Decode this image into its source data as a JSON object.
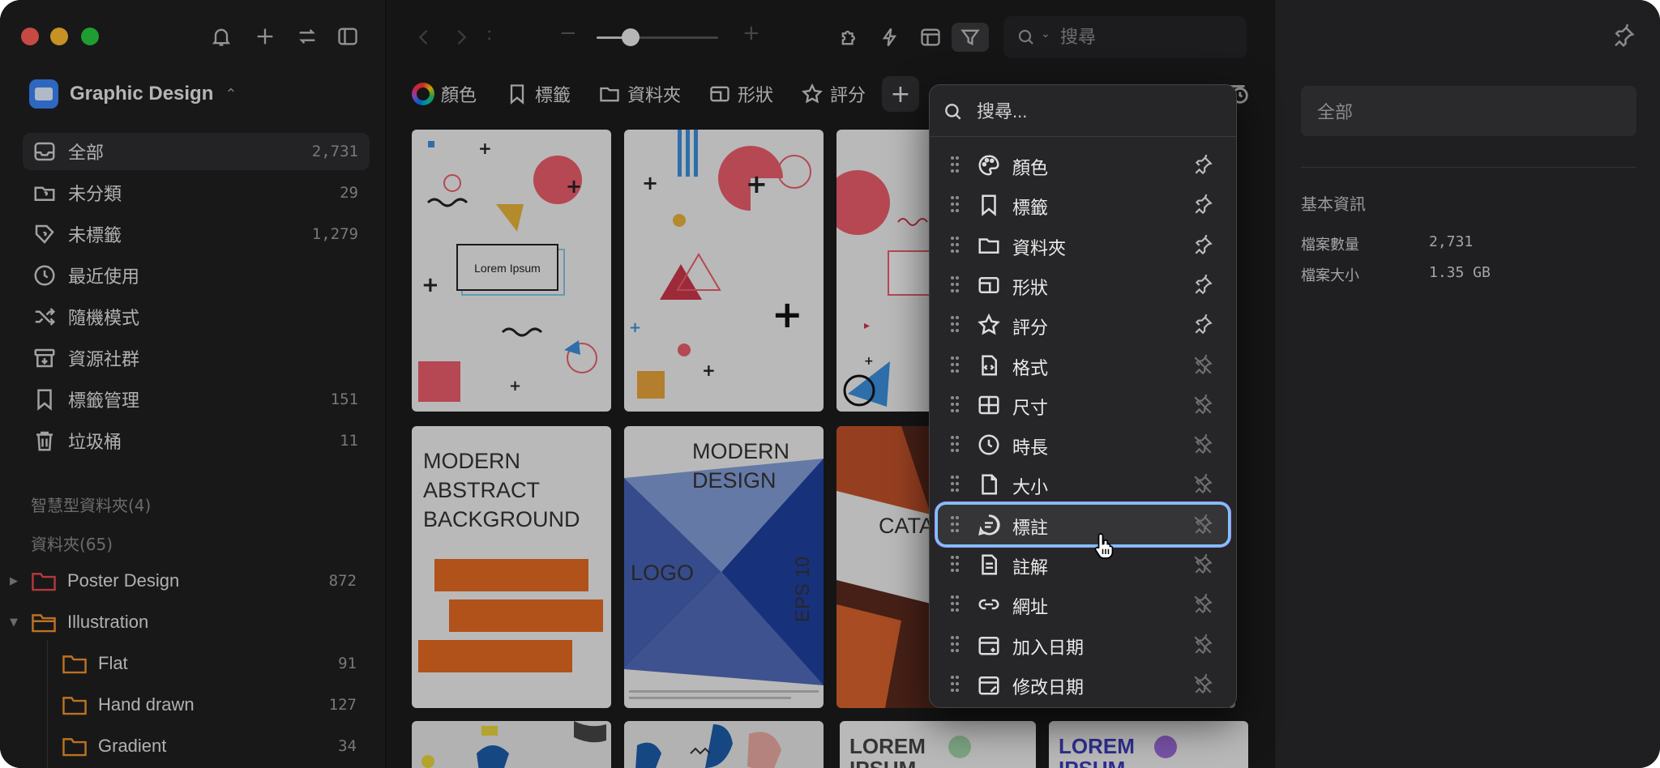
{
  "sidebar": {
    "library_name": "Graphic Design",
    "nav": [
      {
        "label": "全部",
        "count": "2,731",
        "icon": "inbox-icon"
      },
      {
        "label": "未分類",
        "count": "29",
        "icon": "uncategorized-icon"
      },
      {
        "label": "未標籤",
        "count": "1,279",
        "icon": "untagged-icon"
      },
      {
        "label": "最近使用",
        "count": "",
        "icon": "clock-icon"
      },
      {
        "label": "隨機模式",
        "count": "",
        "icon": "shuffle-icon"
      },
      {
        "label": "資源社群",
        "count": "",
        "icon": "community-icon"
      },
      {
        "label": "標籤管理",
        "count": "151",
        "icon": "tag-manager-icon"
      },
      {
        "label": "垃圾桶",
        "count": "11",
        "icon": "trash-icon"
      }
    ],
    "smart_folders_label": "智慧型資料夾(4)",
    "folders_label": "資料夾(65)",
    "folders": [
      {
        "label": "Poster Design",
        "count": "872",
        "color": "#e8484a"
      },
      {
        "label": "Illustration",
        "count": "",
        "color": "#f0932b"
      },
      {
        "label": "Flat",
        "count": "91",
        "color": "#f0932b"
      },
      {
        "label": "Hand drawn",
        "count": "127",
        "color": "#f0932b"
      },
      {
        "label": "Gradient",
        "count": "34",
        "color": "#f0932b"
      }
    ]
  },
  "toolbar": {
    "zoom_separator": ":",
    "zoom_minus": "−",
    "zoom_plus": "+",
    "zoom_level": 0.28,
    "search_placeholder": "搜尋"
  },
  "filters": [
    {
      "label": "顏色",
      "icon": "color-wheel-icon"
    },
    {
      "label": "標籤",
      "icon": "bookmark-icon"
    },
    {
      "label": "資料夾",
      "icon": "folder-icon"
    },
    {
      "label": "形狀",
      "icon": "shape-icon"
    },
    {
      "label": "評分",
      "icon": "star-icon"
    }
  ],
  "add_filter_label": "+",
  "thumbnails": {
    "t1": "Lorem Ipsum",
    "t4_lines": [
      "MODERN",
      "ABSTRACT",
      "BACKGROUND"
    ],
    "t5_lines": [
      "MODERN",
      "DESIGN"
    ],
    "t5_logo": "LOGO",
    "t5_eps": "EPS 10",
    "t6": "CATA",
    "t9": "LOREM",
    "t9b": "IPSUM",
    "t10": "LOREM",
    "t10b": "IPSUM"
  },
  "dropdown": {
    "search_placeholder": "搜尋...",
    "items": [
      {
        "label": "顏色",
        "icon": "palette-icon",
        "pinned": true
      },
      {
        "label": "標籤",
        "icon": "bookmark-icon",
        "pinned": true
      },
      {
        "label": "資料夾",
        "icon": "folder-icon",
        "pinned": true
      },
      {
        "label": "形狀",
        "icon": "shape-icon",
        "pinned": true
      },
      {
        "label": "評分",
        "icon": "star-icon",
        "pinned": true
      },
      {
        "label": "格式",
        "icon": "file-code-icon",
        "pinned": false
      },
      {
        "label": "尺寸",
        "icon": "dimensions-icon",
        "pinned": false
      },
      {
        "label": "時長",
        "icon": "clock-icon",
        "pinned": false
      },
      {
        "label": "大小",
        "icon": "file-icon",
        "pinned": false
      },
      {
        "label": "標註",
        "icon": "annotation-icon",
        "pinned": false,
        "highlighted": true
      },
      {
        "label": "註解",
        "icon": "note-icon",
        "pinned": false
      },
      {
        "label": "網址",
        "icon": "link-icon",
        "pinned": false
      },
      {
        "label": "加入日期",
        "icon": "calendar-add-icon",
        "pinned": false
      },
      {
        "label": "修改日期",
        "icon": "calendar-edit-icon",
        "pinned": false
      }
    ]
  },
  "inspector": {
    "field_value": "全部",
    "section_title": "基本資訊",
    "rows": [
      {
        "label": "檔案數量",
        "value": "2,731"
      },
      {
        "label": "檔案大小",
        "value": "1.35 GB"
      }
    ]
  },
  "colors": {
    "accent": "#3c84f7",
    "highlight_ring": "#7cc4ff",
    "window_bg": "#1c1c1e"
  }
}
